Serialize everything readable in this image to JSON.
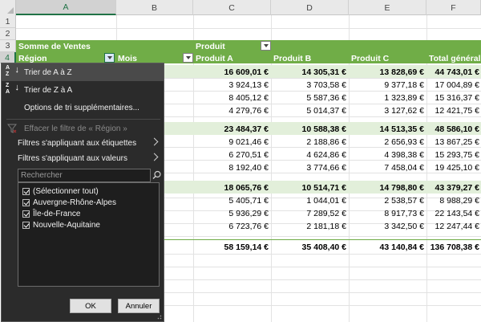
{
  "columns": [
    "A",
    "B",
    "C",
    "D",
    "E",
    "F"
  ],
  "rows": [
    "1",
    "2",
    "3",
    "4"
  ],
  "pivot": {
    "sum_label": "Somme de Ventes",
    "product_label": "Produit",
    "region_label": "Région",
    "month_label": "Mois",
    "col_headers": [
      "Produit A",
      "Produit B",
      "Produit C",
      "Total général"
    ],
    "data_rows": [
      {
        "style": "group",
        "values": [
          "16 609,01 €",
          "14 305,31 €",
          "13 828,69 €",
          "44 743,01 €"
        ]
      },
      {
        "style": "item",
        "values": [
          "3 924,13 €",
          "3 703,58 €",
          "9 377,18 €",
          "17 004,89 €"
        ]
      },
      {
        "style": "item",
        "values": [
          "8 405,12 €",
          "5 587,36 €",
          "1 323,89 €",
          "15 316,37 €"
        ]
      },
      {
        "style": "item",
        "values": [
          "4 279,76 €",
          "5 014,37 €",
          "3 127,62 €",
          "12 421,75 €"
        ]
      },
      {
        "style": "group",
        "values": [
          "23 484,37 €",
          "10 588,38 €",
          "14 513,35 €",
          "48 586,10 €"
        ]
      },
      {
        "style": "item",
        "values": [
          "9 021,46 €",
          "2 188,86 €",
          "2 656,93 €",
          "13 867,25 €"
        ]
      },
      {
        "style": "item",
        "values": [
          "6 270,51 €",
          "4 624,86 €",
          "4 398,38 €",
          "15 293,75 €"
        ]
      },
      {
        "style": "item",
        "values": [
          "8 192,40 €",
          "3 774,66 €",
          "7 458,04 €",
          "19 425,10 €"
        ]
      },
      {
        "style": "group",
        "values": [
          "18 065,76 €",
          "10 514,71 €",
          "14 798,80 €",
          "43 379,27 €"
        ]
      },
      {
        "style": "item",
        "values": [
          "5 405,71 €",
          "1 044,01 €",
          "2 538,57 €",
          "8 988,29 €"
        ]
      },
      {
        "style": "item",
        "values": [
          "5 936,29 €",
          "7 289,52 €",
          "8 917,73 €",
          "22 143,54 €"
        ]
      },
      {
        "style": "item",
        "values": [
          "6 723,76 €",
          "2 181,18 €",
          "3 342,50 €",
          "12 247,44 €"
        ]
      }
    ],
    "grand_total": [
      "58 159,14 €",
      "35 408,40 €",
      "43 140,84 €",
      "136 708,38 €"
    ]
  },
  "menu": {
    "sort_az": "Trier de A à Z",
    "sort_za": "Trier de Z à A",
    "sort_more": "Options de tri supplémentaires...",
    "clear_filter": "Effacer le filtre de « Région »",
    "label_filters": "Filtres s'appliquant aux étiquettes",
    "value_filters": "Filtres s'appliquant aux valeurs",
    "search_placeholder": "Rechercher",
    "items": [
      "(Sélectionner tout)",
      "Auvergne-Rhône-Alpes",
      "Île-de-France",
      "Nouvelle-Aquitaine"
    ],
    "ok": "OK",
    "cancel": "Annuler"
  },
  "colors": {
    "header_green": "#70ad47",
    "band_light": "#e2efda",
    "menu_bg": "#2b2b2b",
    "excel_green": "#217346"
  }
}
